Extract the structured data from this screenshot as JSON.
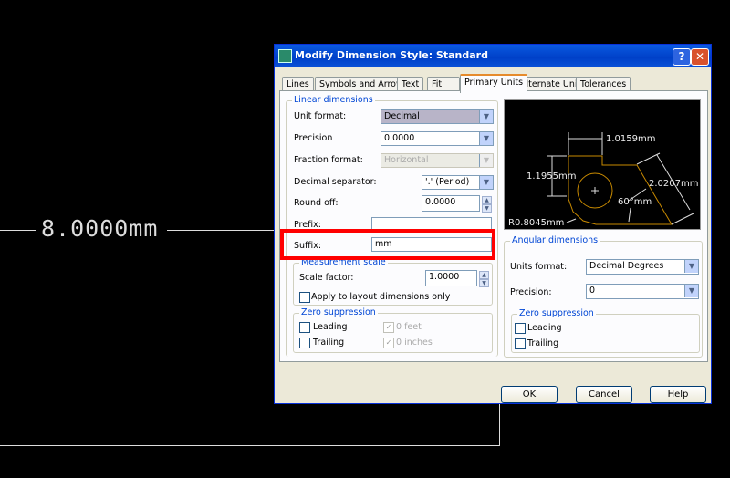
{
  "drawing": {
    "dimension_text": "8.0000mm"
  },
  "dialog": {
    "title": "Modify Dimension Style: Standard",
    "help_btn": "?",
    "close_btn": "✕",
    "tabs": [
      {
        "label": "Lines"
      },
      {
        "label": "Symbols and Arrows"
      },
      {
        "label": "Text"
      },
      {
        "label": "Fit"
      },
      {
        "label": "Primary Units",
        "active": true
      },
      {
        "label": "Alternate Units"
      },
      {
        "label": "Tolerances"
      }
    ],
    "linear": {
      "title": "Linear dimensions",
      "unit_format_label": "Unit format:",
      "unit_format": "Decimal",
      "precision_label": "Precision",
      "precision": "0.0000",
      "fraction_format_label": "Fraction format:",
      "fraction_format": "Horizontal",
      "decimal_sep_label": "Decimal separator:",
      "decimal_sep": "'.' (Period)",
      "round_off_label": "Round off:",
      "round_off": "0.0000",
      "prefix_label": "Prefix:",
      "prefix": "",
      "suffix_label": "Suffix:",
      "suffix": "mm"
    },
    "measurement": {
      "title": "Measurement scale",
      "scale_label": "Scale factor:",
      "scale": "1.0000",
      "layout_only": "Apply to layout dimensions only"
    },
    "zero": {
      "title": "Zero suppression",
      "leading": "Leading",
      "trailing": "Trailing",
      "feet": "0 feet",
      "inches": "0 inches"
    },
    "preview": {
      "h": "1.0159mm",
      "v": "1.1955mm",
      "d": "2.0207mm",
      "ang": "60°mm",
      "r": "R0.8045mm"
    },
    "angular": {
      "title": "Angular dimensions",
      "units_label": "Units format:",
      "units": "Decimal Degrees",
      "precision_label": "Precision:",
      "precision": "0",
      "zero_title": "Zero suppression",
      "leading": "Leading",
      "trailing": "Trailing"
    },
    "buttons": {
      "ok": "OK",
      "cancel": "Cancel",
      "help": "Help"
    },
    "highlight_color": "#ff0000"
  }
}
